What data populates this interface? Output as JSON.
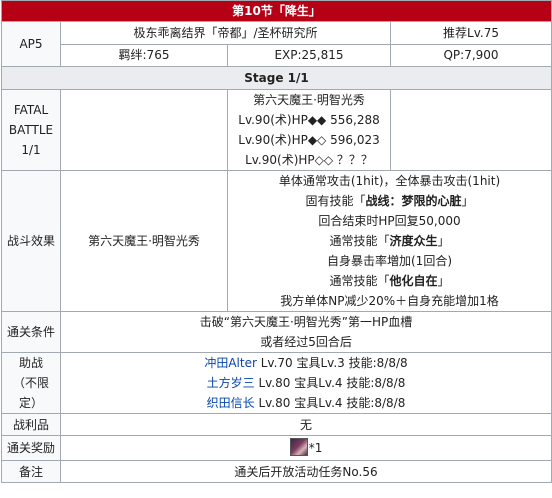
{
  "title": "第10节「降生」",
  "ap": "AP5",
  "location": "极东乖离结界「帝都」/圣杯研究所",
  "recommend": "推荐Lv.75",
  "bond": "羁绊:765",
  "exp": "EXP:25,815",
  "qp": "QP:7,900",
  "stage": "Stage 1/1",
  "battle": {
    "label_lines": [
      "FATAL",
      "BATTLE",
      "1/1"
    ],
    "enemy_name": "第六天魔王·明智光秀",
    "enemy_lines": [
      "Lv.90(术)HP◆◆ 556,288",
      "Lv.90(术)HP◆◇ 596,023",
      "Lv.90(术)HP◇◇ ？？？"
    ]
  },
  "effects": {
    "label": "战斗效果",
    "enemy": "第六天魔王·明智光秀",
    "line1": "单体通常攻击(1hit)，全体暴击攻击(1hit)",
    "line2_prefix": "固有技能「",
    "line2_bold": "战线：梦限的心脏",
    "line2_suffix": "」",
    "line3": "回合结束时HP回复50,000",
    "line4_prefix": "通常技能「",
    "line4_bold": "济度众生",
    "line4_suffix": "」",
    "line5": "自身暴击率増加(1回合)",
    "line6_prefix": "通常技能「",
    "line6_bold": "他化自在",
    "line6_suffix": "」",
    "line7": "我方单体NP减少20%＋自身充能增加1格"
  },
  "clear": {
    "label": "通关条件",
    "line1": "击破“第六天魔王·明智光秀”第一HP血槽",
    "line2": "或者经过5回合后"
  },
  "support": {
    "label_lines": [
      "助战",
      "（不限",
      "定）"
    ],
    "rows": [
      {
        "name": "冲田Alter",
        "rest": " Lv.70 宝具Lv.3 技能:8/8/8"
      },
      {
        "name": "土方岁三",
        "rest": " Lv.80 宝具Lv.4 技能:8/8/8"
      },
      {
        "name": "织田信长",
        "rest": " Lv.80 宝具Lv.4 技能:8/8/8"
      }
    ]
  },
  "drops": {
    "label": "战利品",
    "value": "无"
  },
  "reward": {
    "label": "通关奖励",
    "count": "*1"
  },
  "note": {
    "label": "备注",
    "value": "通关后开放活动任务No.56"
  }
}
